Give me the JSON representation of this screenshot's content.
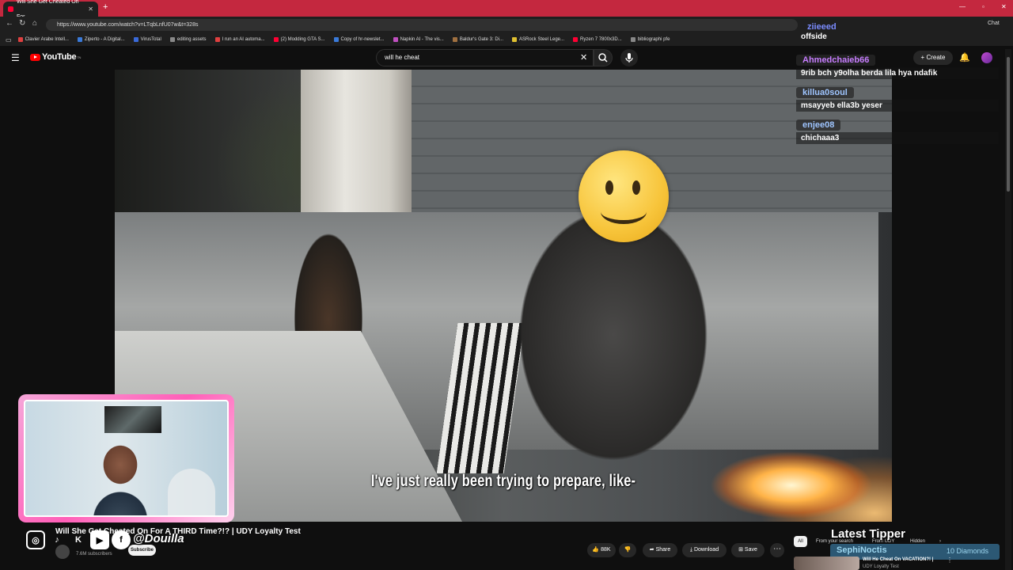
{
  "browser": {
    "tab_title": "Will She Get Cheated On For",
    "new_tab": "+",
    "url": "https://www.youtube.com/watch?v=LTqbLnfU07w&t=328s",
    "extensions_chat": "Chat",
    "bookmarks": [
      {
        "label": "Clavier Arabe Intell...",
        "color": "#e04040"
      },
      {
        "label": "Ziperto - A Digital...",
        "color": "#3a7ad9"
      },
      {
        "label": "VirusTotal",
        "color": "#3a6ad9"
      },
      {
        "label": "editing assets",
        "color": "#888888"
      },
      {
        "label": "I run an AI automa...",
        "color": "#e04040"
      },
      {
        "label": "(2) Modding GTA S...",
        "color": "#ff0033"
      },
      {
        "label": "Copy of hr-newslet...",
        "color": "#3a7ad9"
      },
      {
        "label": "Napkin AI - The vis...",
        "color": "#c050c0"
      },
      {
        "label": "Baldur's Gate 3: Di...",
        "color": "#a07040"
      },
      {
        "label": "ASRock Steel Lege...",
        "color": "#e0c030"
      },
      {
        "label": "Ryzen 7 7800x3D...",
        "color": "#ff0033"
      },
      {
        "label": "bibliographi pfe",
        "color": "#888888"
      }
    ]
  },
  "youtube": {
    "logo": "YouTube",
    "logo_sup": "TN",
    "search_value": "will he cheat",
    "create_label": "Create",
    "video_title": "Will She Get Cheated On For A THIRD Time?!? | UDY Loyalty Test",
    "subscribers": "7.6M subscribers",
    "subscribe_label": "Subscribe",
    "likes": "88K",
    "share_label": "Share",
    "download_label": "Download",
    "save_label": "Save",
    "chips": {
      "all": "All",
      "from_search": "From your search",
      "from_udy": "From UDY",
      "hidden": "Hidden"
    },
    "rec_title": "Will He Cheat On VACATION?! |",
    "rec_channel": "UDY Loyalty Test"
  },
  "video": {
    "subtitle": "I've just really been trying to prepare, like-"
  },
  "chat": [
    {
      "user": "ziieeed",
      "text": "offside",
      "color": "#7b8cff"
    },
    {
      "user": "Ahmedchaieb66",
      "text": "9rib bch y9olha berda lila hya ndafik",
      "color": "#c77dff"
    },
    {
      "user": "killua0soul",
      "text": "msayyeb ella3b yeser",
      "color": "#9fc5ff"
    },
    {
      "user": "enjee08",
      "text": "chichaaa3",
      "color": "#9fc5ff"
    }
  ],
  "overlay": {
    "handle": "@Douilla",
    "latest_tipper_label": "Latest Tipper",
    "tipper_name": "SephiNoctis",
    "tipper_amount": "10 Diamonds"
  }
}
